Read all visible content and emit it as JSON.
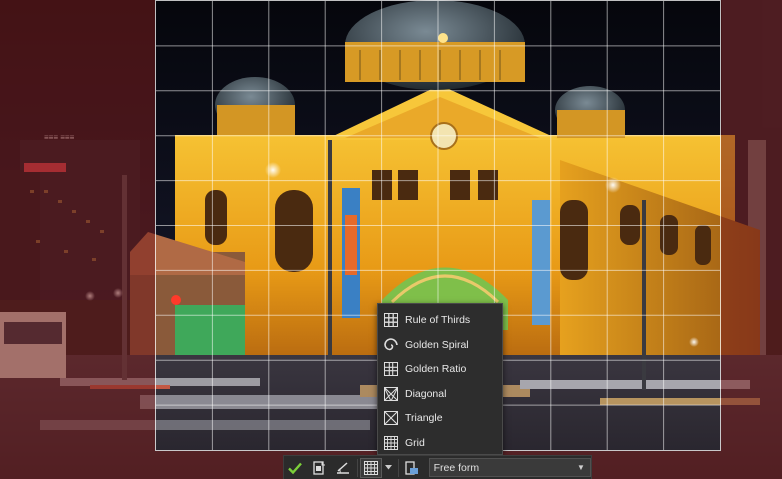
{
  "overlay_menu": {
    "items": [
      {
        "label": "Rule of Thirds",
        "icon": "rule-of-thirds-icon"
      },
      {
        "label": "Golden Spiral",
        "icon": "golden-spiral-icon"
      },
      {
        "label": "Golden Ratio",
        "icon": "golden-ratio-icon"
      },
      {
        "label": "Diagonal",
        "icon": "diagonal-icon"
      },
      {
        "label": "Triangle",
        "icon": "triangle-icon"
      },
      {
        "label": "Grid",
        "icon": "grid-icon"
      }
    ]
  },
  "toolbar": {
    "buttons": [
      {
        "icon": "checkmark-icon"
      },
      {
        "icon": "crop-to-new-image-icon"
      },
      {
        "icon": "straighten-icon"
      },
      {
        "icon": "grid-overlay-icon"
      },
      {
        "icon": "chevron-down-icon"
      },
      {
        "icon": "orientation-icon"
      }
    ],
    "aspect_ratio_value": "Free form"
  },
  "colors": {
    "crop_outside_tint": "#781e1e",
    "menu_background": "#2d2d2d",
    "toolbar_background": "#2b2b2b",
    "confirm_green": "#7ccf3a"
  }
}
